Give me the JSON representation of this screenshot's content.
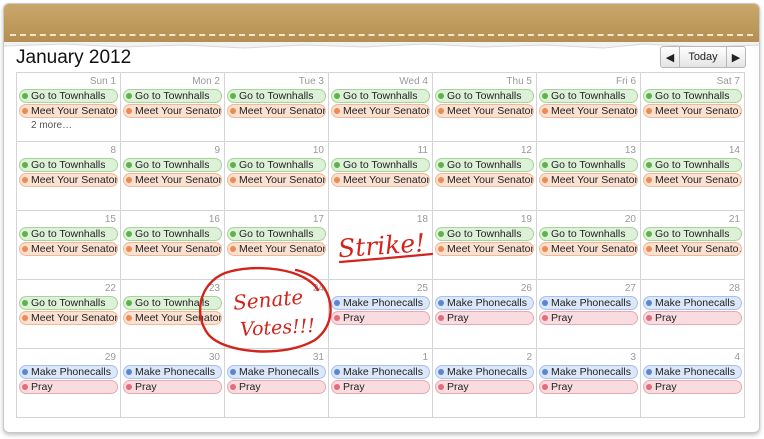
{
  "calendar": {
    "month_title": "January 2012",
    "nav": {
      "prev": "◀",
      "today": "Today",
      "next": "▶"
    },
    "colors": {
      "green": "#5db34a",
      "orange": "#ef8a50",
      "blue": "#5a86d6",
      "pink": "#e26c7a",
      "ink": "#d1241c"
    },
    "cells": [
      {
        "day": "Sun 1",
        "events": [
          {
            "label": "Go to Townhalls",
            "color": "green"
          },
          {
            "label": "Meet Your Senators",
            "color": "orange"
          }
        ],
        "more": "2 more…"
      },
      {
        "day": "Mon 2",
        "events": [
          {
            "label": "Go to Townhalls",
            "color": "green"
          },
          {
            "label": "Meet Your Senators",
            "color": "orange"
          }
        ]
      },
      {
        "day": "Tue 3",
        "events": [
          {
            "label": "Go to Townhalls",
            "color": "green"
          },
          {
            "label": "Meet Your Senators",
            "color": "orange"
          }
        ]
      },
      {
        "day": "Wed 4",
        "events": [
          {
            "label": "Go to Townhalls",
            "color": "green"
          },
          {
            "label": "Meet Your Senators",
            "color": "orange"
          }
        ]
      },
      {
        "day": "Thu 5",
        "events": [
          {
            "label": "Go to Townhalls",
            "color": "green"
          },
          {
            "label": "Meet Your Senators",
            "color": "orange"
          }
        ]
      },
      {
        "day": "Fri 6",
        "events": [
          {
            "label": "Go to Townhalls",
            "color": "green"
          },
          {
            "label": "Meet Your Senators",
            "color": "orange"
          }
        ]
      },
      {
        "day": "Sat 7",
        "events": [
          {
            "label": "Go to Townhalls",
            "color": "green"
          },
          {
            "label": "Meet Your Senato…",
            "color": "orange"
          }
        ]
      },
      {
        "day": "8",
        "events": [
          {
            "label": "Go to Townhalls",
            "color": "green"
          },
          {
            "label": "Meet Your Senators",
            "color": "orange"
          }
        ]
      },
      {
        "day": "9",
        "events": [
          {
            "label": "Go to Townhalls",
            "color": "green"
          },
          {
            "label": "Meet Your Senators",
            "color": "orange"
          }
        ]
      },
      {
        "day": "10",
        "events": [
          {
            "label": "Go to Townhalls",
            "color": "green"
          },
          {
            "label": "Meet Your Senators",
            "color": "orange"
          }
        ]
      },
      {
        "day": "11",
        "events": [
          {
            "label": "Go to Townhalls",
            "color": "green"
          },
          {
            "label": "Meet Your Senators",
            "color": "orange"
          }
        ]
      },
      {
        "day": "12",
        "events": [
          {
            "label": "Go to Townhalls",
            "color": "green"
          },
          {
            "label": "Meet Your Senators",
            "color": "orange"
          }
        ]
      },
      {
        "day": "13",
        "events": [
          {
            "label": "Go to Townhalls",
            "color": "green"
          },
          {
            "label": "Meet Your Senators",
            "color": "orange"
          }
        ]
      },
      {
        "day": "14",
        "events": [
          {
            "label": "Go to Townhalls",
            "color": "green"
          },
          {
            "label": "Meet Your Senato…",
            "color": "orange"
          }
        ]
      },
      {
        "day": "15",
        "events": [
          {
            "label": "Go to Townhalls",
            "color": "green"
          },
          {
            "label": "Meet Your Senators",
            "color": "orange"
          }
        ]
      },
      {
        "day": "16",
        "events": [
          {
            "label": "Go to Townhalls",
            "color": "green"
          },
          {
            "label": "Meet Your Senators",
            "color": "orange"
          }
        ]
      },
      {
        "day": "17",
        "events": [
          {
            "label": "Go to Townhalls",
            "color": "green"
          },
          {
            "label": "Meet Your Senators",
            "color": "orange"
          }
        ]
      },
      {
        "day": "18",
        "events": []
      },
      {
        "day": "19",
        "events": [
          {
            "label": "Go to Townhalls",
            "color": "green"
          },
          {
            "label": "Meet Your Senators",
            "color": "orange"
          }
        ]
      },
      {
        "day": "20",
        "events": [
          {
            "label": "Go to Townhalls",
            "color": "green"
          },
          {
            "label": "Meet Your Senators",
            "color": "orange"
          }
        ]
      },
      {
        "day": "21",
        "events": [
          {
            "label": "Go to Townhalls",
            "color": "green"
          },
          {
            "label": "Meet Your Senato…",
            "color": "orange"
          }
        ]
      },
      {
        "day": "22",
        "events": [
          {
            "label": "Go to Townhalls",
            "color": "green"
          },
          {
            "label": "Meet Your Senators",
            "color": "orange"
          }
        ]
      },
      {
        "day": "23",
        "events": [
          {
            "label": "Go to Townhalls",
            "color": "green"
          },
          {
            "label": "Meet Your Senators",
            "color": "orange"
          }
        ]
      },
      {
        "day": "24",
        "events": []
      },
      {
        "day": "25",
        "events": [
          {
            "label": "Make Phonecalls",
            "color": "blue"
          },
          {
            "label": "Pray",
            "color": "pink"
          }
        ]
      },
      {
        "day": "26",
        "events": [
          {
            "label": "Make Phonecalls",
            "color": "blue"
          },
          {
            "label": "Pray",
            "color": "pink"
          }
        ]
      },
      {
        "day": "27",
        "events": [
          {
            "label": "Make Phonecalls",
            "color": "blue"
          },
          {
            "label": "Pray",
            "color": "pink"
          }
        ]
      },
      {
        "day": "28",
        "events": [
          {
            "label": "Make Phonecalls",
            "color": "blue"
          },
          {
            "label": "Pray",
            "color": "pink"
          }
        ]
      },
      {
        "day": "29",
        "events": [
          {
            "label": "Make Phonecalls",
            "color": "blue"
          },
          {
            "label": "Pray",
            "color": "pink"
          }
        ]
      },
      {
        "day": "30",
        "events": [
          {
            "label": "Make Phonecalls",
            "color": "blue"
          },
          {
            "label": "Pray",
            "color": "pink"
          }
        ]
      },
      {
        "day": "31",
        "events": [
          {
            "label": "Make Phonecalls",
            "color": "blue"
          },
          {
            "label": "Pray",
            "color": "pink"
          }
        ]
      },
      {
        "day": "1",
        "events": [
          {
            "label": "Make Phonecalls",
            "color": "blue"
          },
          {
            "label": "Pray",
            "color": "pink"
          }
        ]
      },
      {
        "day": "2",
        "events": [
          {
            "label": "Make Phonecalls",
            "color": "blue"
          },
          {
            "label": "Pray",
            "color": "pink"
          }
        ]
      },
      {
        "day": "3",
        "events": [
          {
            "label": "Make Phonecalls",
            "color": "blue"
          },
          {
            "label": "Pray",
            "color": "pink"
          }
        ]
      },
      {
        "day": "4",
        "events": [
          {
            "label": "Make Phonecalls",
            "color": "blue"
          },
          {
            "label": "Pray",
            "color": "pink"
          }
        ]
      }
    ],
    "annotations": {
      "strike": "Strike!",
      "senate_line1": "Senate",
      "senate_line2": "Votes!!!"
    }
  }
}
